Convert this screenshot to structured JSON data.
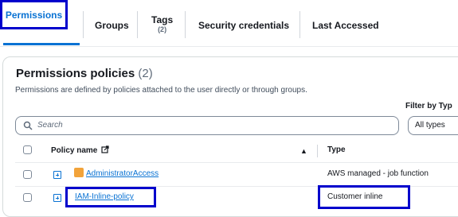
{
  "tabs": [
    {
      "label": "Permissions"
    },
    {
      "label": "Groups"
    },
    {
      "label": "Tags",
      "sub": "(2)"
    },
    {
      "label": "Security credentials"
    },
    {
      "label": "Last Accessed"
    }
  ],
  "section": {
    "title": "Permissions policies",
    "count": "(2)",
    "description": "Permissions are defined by policies attached to the user directly or through groups."
  },
  "filter": {
    "label": "Filter by Typ",
    "value": "All types"
  },
  "search": {
    "placeholder": "Search"
  },
  "table": {
    "columns": [
      "Policy name",
      "Type"
    ],
    "rows": [
      {
        "name": "AdministratorAccess",
        "type": "AWS managed - job function"
      },
      {
        "name": "IAM-Inline-policy",
        "type": "Customer inline"
      }
    ]
  },
  "colors": {
    "accent": "#0972d3",
    "highlight": "#0000cc",
    "aws_badge": "#f2a33a"
  },
  "icons": [
    "search-icon",
    "external-link-icon",
    "sort-ascending-icon",
    "expand-icon",
    "aws-managed-icon"
  ]
}
